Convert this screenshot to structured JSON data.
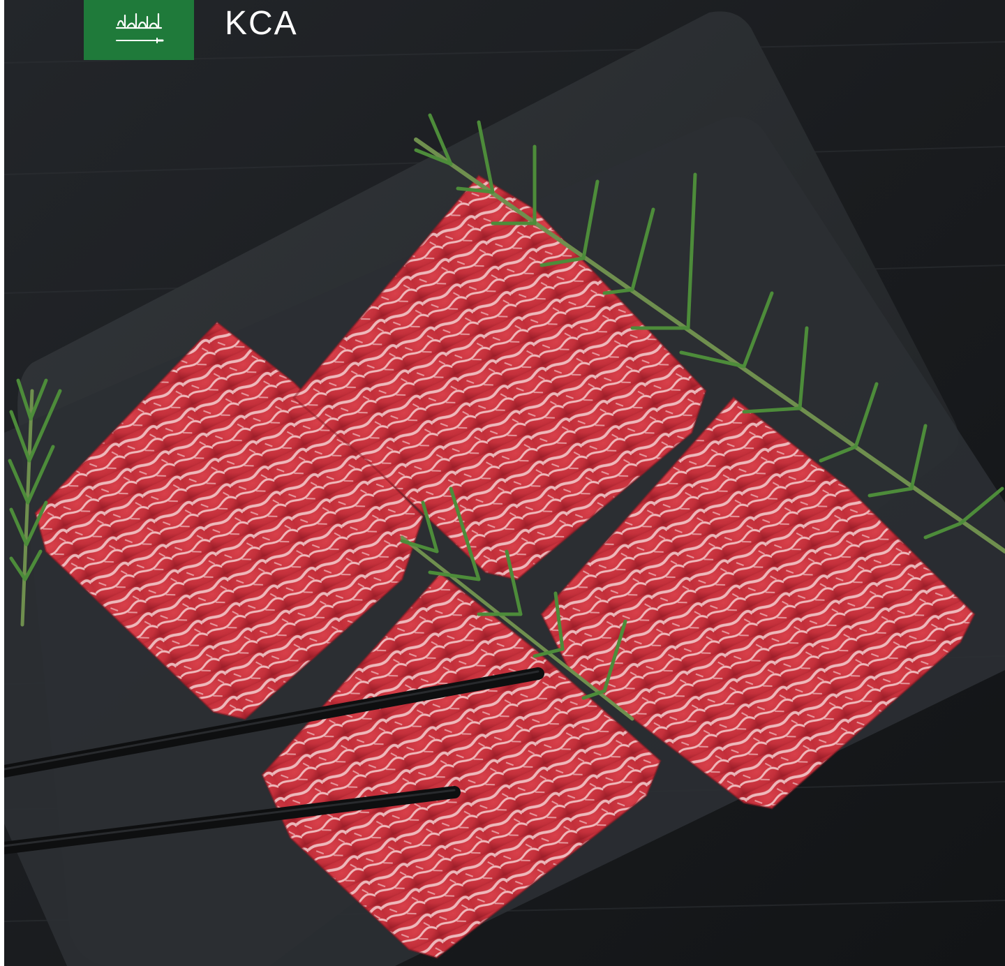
{
  "header": {
    "country_code": "KCA",
    "flag_icon": "saudi-arabia-flag-icon",
    "flag_color": "#1f7a3a"
  },
  "photo": {
    "subject": "raw-marbled-beef-slices",
    "colors": {
      "background_wood": "#1b1d1f",
      "slate_board": "#2a2d30",
      "meat": "#c8313c",
      "fat_marbling": "#f2c9c9",
      "rosemary": "#4d8c3a",
      "chopsticks": "#0e0f10"
    }
  }
}
